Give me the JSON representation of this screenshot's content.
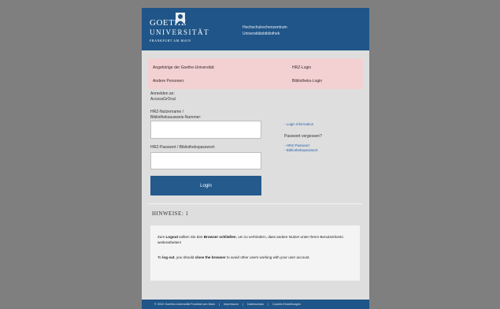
{
  "header": {
    "logo_goethe": "GOETHE",
    "logo_universitat": "UNIVERSITÄT",
    "logo_ffm": "FRANKFURT AM MAIN",
    "library_line1": "Hochschulrechenzentrum",
    "library_line2": "Universitätsbibliothek"
  },
  "info_band": {
    "left1": "Angehörige der Goethe-Universität:",
    "left2": "Andere Personen:",
    "right1": "HRZ-Login",
    "right2": "Bibliotheks-Login"
  },
  "form": {
    "signin_line1": "Anmelden an:",
    "signin_line2": "AccessGrOcal",
    "username_label_line1": "HRZ-Nutzername /",
    "username_label_line2": "Bibliotheksausweis-Nummer:",
    "username_value": "",
    "password_label": "HRZ-Passwort / Bibliothekspasswort:",
    "password_value": "",
    "login_label": "Login"
  },
  "side_links": {
    "login_information": "- Login information",
    "forgot_password": "Passwort vergessen?",
    "hrz_password": "- HRZ-Passwort",
    "library_password": "- Bibliothekspasswort"
  },
  "hints": {
    "title": "HINWEISE: 1",
    "p1_pre": "Zum ",
    "p1_bold1": "Logout",
    "p1_mid": " sollten Sie den ",
    "p1_bold2": "Browser schließen",
    "p1_post": ", um zu verhindern, dass andere Nutzer unter Ihrem Benutzerkonto weiterarbeiten!",
    "p2_pre": "To ",
    "p2_bold1": "log out",
    "p2_mid": ", you should ",
    "p2_bold2": "close the browser",
    "p2_post": " to avoid other users working with your user account."
  },
  "footer": {
    "copyright": "© 2022 Goethe-Universität Frankfurt am Main",
    "sep": "|",
    "impressum": "Impressum",
    "datenschutz": "Datenschutz",
    "cookie": "Cookie-Einstellungen"
  },
  "colors": {
    "brand_blue": "#1f5588",
    "band_pink": "#f3d1d3",
    "page_grey": "#7f7f7f",
    "panel_grey": "#dedede"
  }
}
